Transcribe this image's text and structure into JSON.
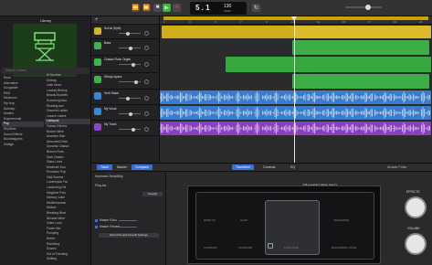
{
  "toolbar": {
    "position": "5 . 1",
    "tempo": "130",
    "tempo_sub": "KEEP",
    "rewind_icon": "⏪",
    "forward_icon": "⏩",
    "stop_icon": "■",
    "play_icon": "▶",
    "record_icon": "●",
    "cycle_icon": "↻"
  },
  "library": {
    "title": "Library",
    "search_placeholder": "Search Library",
    "categories": [
      "Rock",
      "Alternative",
      "Songwriter",
      "R&B",
      "Electronic",
      "Hip Hop",
      "Dubstep",
      "Modern",
      "Experimental",
      "Pop",
      "Rhythmic",
      "Sound Effects",
      "Boombappers",
      "Vintage"
    ],
    "sounds": [
      "Hi Number",
      "Dirtbag",
      "Indie Disco",
      "Lowkey Bkdrop",
      "Beauty Buddies",
      "Scorching Asia",
      "Reading Ave",
      "Graceful Ladies",
      "Leaven Ladies",
      "Liverpool",
      "Classic Electric",
      "Broken Wine",
      "Anaheim Man",
      "Armoured Drive",
      "Dynamic Classic",
      "Bronco Rock",
      "Dark Classic",
      "Glass Lines",
      "Moderate Doo",
      "Phoneme Pop",
      "Vital Sunrise",
      "Lumberjack Fat",
      "Lumbering Fat",
      "Megaline Pow",
      "Memory Lake",
      "Mediterranean",
      "Mellow",
      "Breaking Beat",
      "Nirvana Wren",
      "Outer Loud",
      "Power Mix",
      "Pumping",
      "Reflex",
      "Rambling",
      "Scared",
      "Set of Traveling",
      "Shifting"
    ]
  },
  "tracks": [
    {
      "name": "SoCal (Kyle)",
      "color": "#d4b51e"
    },
    {
      "name": "Bass",
      "color": "#3bb54a"
    },
    {
      "name": "Classic Rock Organ",
      "color": "#3bb54a"
    },
    {
      "name": "String Layers",
      "color": "#3bb54a"
    },
    {
      "name": "Verb Stack",
      "color": "#3b86d8"
    },
    {
      "name": "My Vocal",
      "color": "#3b86d8"
    },
    {
      "name": "My Track",
      "color": "#8e44c8"
    }
  ],
  "arrange": {
    "ticks": [
      "1",
      "3",
      "5",
      "7",
      "9",
      "11",
      "13",
      "15",
      "17",
      "19",
      "21"
    ]
  },
  "editor": {
    "tabs": [
      "Track",
      "Master",
      "Compare",
      "Transform",
      "Controls",
      "EQ"
    ],
    "region_label": "Arcade Pulse",
    "keyboard_sensitivity": "Keyboard Sensitivity",
    "plug_ins": "Plug-ins",
    "plugin_btn": "Smooth",
    "master_echo": "Master Echo",
    "master_reverb": "Master Reverb",
    "edit_btn": "Edit Units and Smooth Settings",
    "transform_title": "TRANSFORM PAD",
    "pad_top": [
      "ROBOTIC",
      "GIANT",
      "BRIGHT",
      "TELEPHONE"
    ],
    "pad_bottom": [
      "CHIPMUNK",
      "STANDARD",
      "LOW VOICE",
      "BACKWARDS VOICE"
    ],
    "effects_label": "EFFECTS",
    "volume_label": "VOLUME"
  }
}
